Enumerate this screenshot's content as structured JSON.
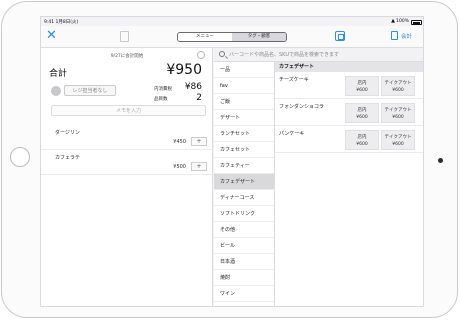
{
  "status_bar": {
    "time": "9:41 1月8日(火)",
    "battery": "100%",
    "wifi": "▲"
  },
  "top_nav": {
    "close_icon": "✕",
    "segments": [
      "メニュー",
      "タグ・顧客"
    ],
    "checkout_label": "会計"
  },
  "order": {
    "start_label": "9/27に会計開始",
    "total_label": "合計",
    "total_value": "¥950",
    "staff_button": "レジ担当者なし",
    "tax_label": "内消費税",
    "tax_value": "¥86",
    "count_label": "品目数",
    "count_value": "2",
    "memo_placeholder": "メモを入力",
    "items": [
      {
        "name": "ダージリン",
        "price": "¥450",
        "plus": "+"
      },
      {
        "name": "カフェラテ",
        "price": "¥500",
        "plus": "+"
      }
    ]
  },
  "search": {
    "placeholder": "バーコードや商品名、SKUで商品を検索できます"
  },
  "categories": [
    {
      "label": "一品",
      "selected": false
    },
    {
      "label": "fav",
      "selected": false
    },
    {
      "label": "ご飯",
      "selected": false
    },
    {
      "label": "デザート",
      "selected": false
    },
    {
      "label": "ランチセット",
      "selected": false
    },
    {
      "label": "カフェセット",
      "selected": false
    },
    {
      "label": "カフェティー",
      "selected": false
    },
    {
      "label": "カフェデザート",
      "selected": true
    },
    {
      "label": "ディナーコース",
      "selected": false
    },
    {
      "label": "ソフトドリンク",
      "selected": false
    },
    {
      "label": "その他",
      "selected": false
    },
    {
      "label": "ビール",
      "selected": false
    },
    {
      "label": "日本酒",
      "selected": false
    },
    {
      "label": "焼酎",
      "selected": false
    },
    {
      "label": "ワイン",
      "selected": false
    }
  ],
  "products": {
    "header": "カフェデザート",
    "rows": [
      {
        "name": "チーズケーキ",
        "opt1_label": "店内",
        "opt1_price": "¥600",
        "opt2_label": "テイクアウト",
        "opt2_price": "¥600"
      },
      {
        "name": "フォンダンショコラ",
        "opt1_label": "店内",
        "opt1_price": "¥600",
        "opt2_label": "テイクアウト",
        "opt2_price": "¥600"
      },
      {
        "name": "パンケーキ",
        "opt1_label": "店内",
        "opt1_price": "¥600",
        "opt2_label": "テイクアウト",
        "opt2_price": "¥600"
      }
    ]
  },
  "colors": {
    "accent": "#2c8cf0",
    "selected_category": "#d9d9dc"
  }
}
